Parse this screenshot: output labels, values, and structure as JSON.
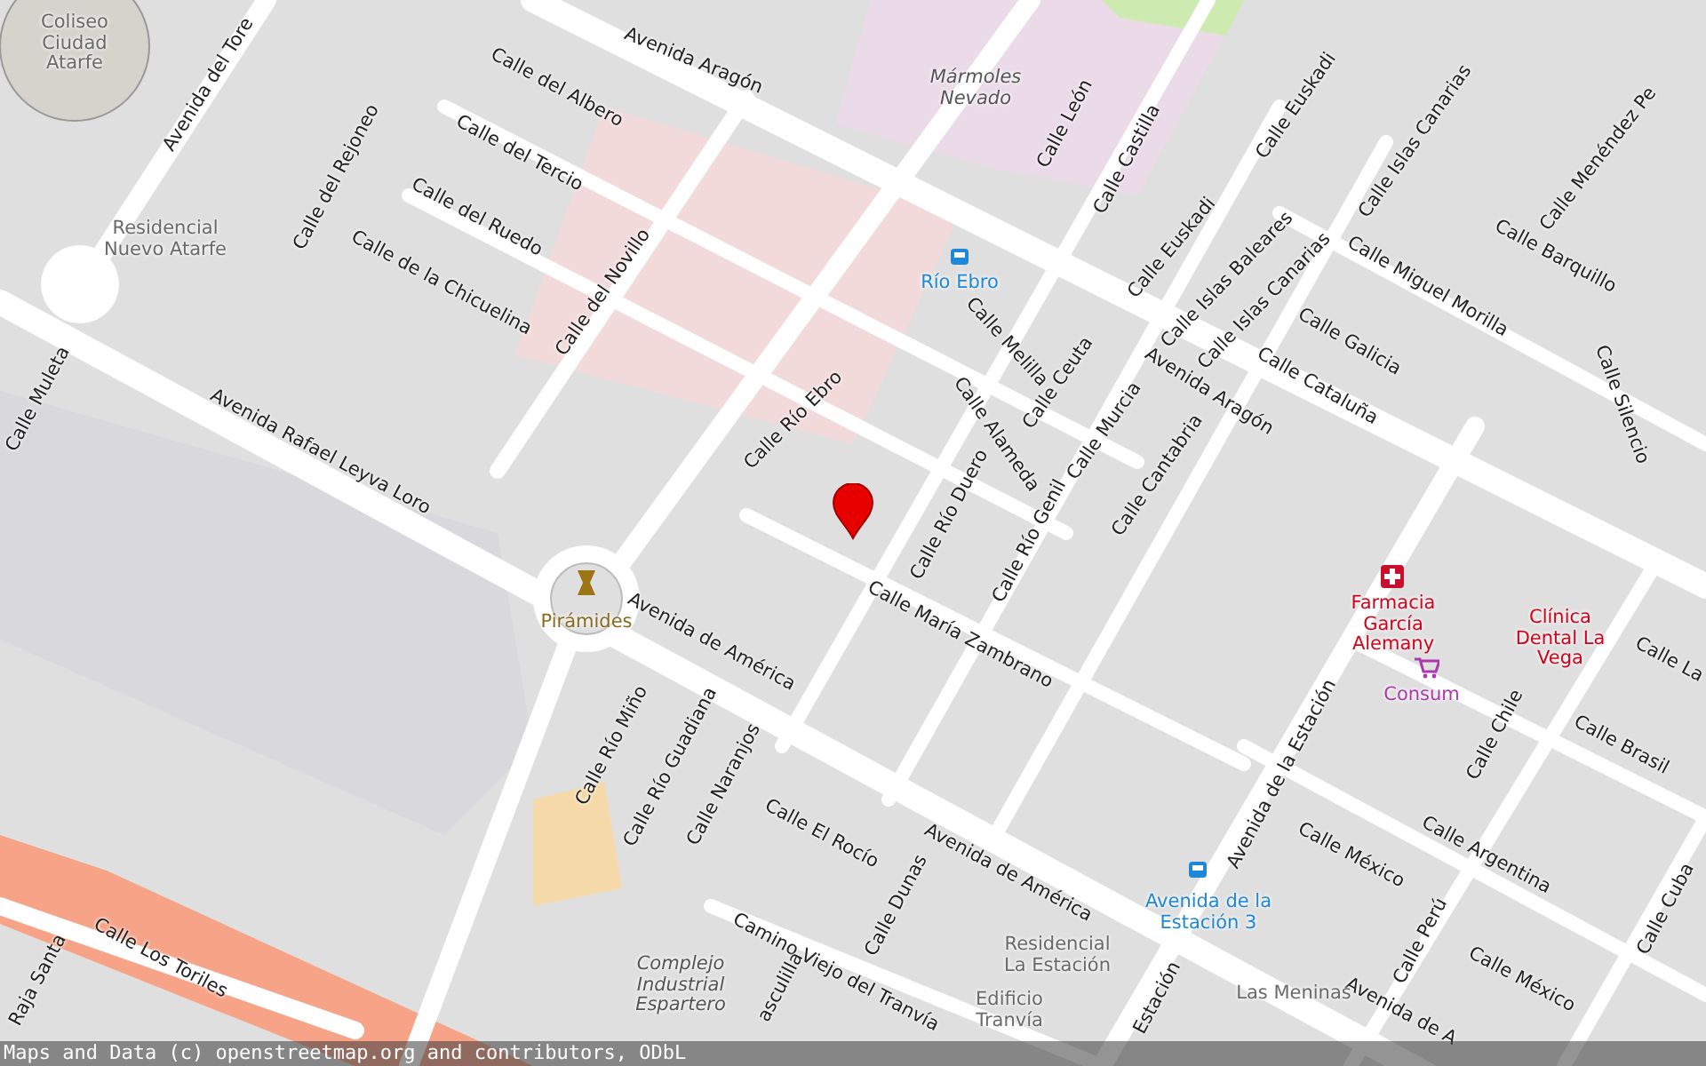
{
  "map": {
    "labels": [
      {
        "text": "Avenida del Tore",
        "kind": "street"
      },
      {
        "text": "Calle del Albero",
        "kind": "street"
      },
      {
        "text": "Avenida Aragón",
        "kind": "street"
      },
      {
        "text": "Calle del Tercio",
        "kind": "street"
      },
      {
        "text": "Calle del Rejoneo",
        "kind": "street"
      },
      {
        "text": "Calle del Ruedo",
        "kind": "street"
      },
      {
        "text": "Calle de la Chicuelina",
        "kind": "street"
      },
      {
        "text": "Calle del Novillo",
        "kind": "street"
      },
      {
        "text": "Calle Muleta",
        "kind": "street"
      },
      {
        "text": "Avenida Rafael Leyva Loro",
        "kind": "street"
      },
      {
        "text": "Calle Río Ebro",
        "kind": "street"
      },
      {
        "text": "Calle Melilla",
        "kind": "street"
      },
      {
        "text": "Calle Ceuta",
        "kind": "street"
      },
      {
        "text": "Calle Alameda",
        "kind": "street"
      },
      {
        "text": "Calle Río Duero",
        "kind": "street"
      },
      {
        "text": "Calle Murcia",
        "kind": "street"
      },
      {
        "text": "Calle Río Genil",
        "kind": "street"
      },
      {
        "text": "Calle Cantabria",
        "kind": "street"
      },
      {
        "text": "Avenida Aragón",
        "kind": "street"
      },
      {
        "text": "Calle León",
        "kind": "street"
      },
      {
        "text": "Calle Castilla",
        "kind": "street"
      },
      {
        "text": "Calle Euskadi",
        "kind": "street"
      },
      {
        "text": "Calle Euskadi",
        "kind": "street"
      },
      {
        "text": "Calle Islas Baleares",
        "kind": "street"
      },
      {
        "text": "Calle Islas Canarias",
        "kind": "street"
      },
      {
        "text": "Calle Islas Canarias",
        "kind": "street"
      },
      {
        "text": "Calle Menéndez Pe",
        "kind": "street"
      },
      {
        "text": "Calle Barquillo",
        "kind": "street"
      },
      {
        "text": "Calle Miguel Morilla",
        "kind": "street"
      },
      {
        "text": "Calle Galicia",
        "kind": "street"
      },
      {
        "text": "Calle Cataluña",
        "kind": "street"
      },
      {
        "text": "Calle Silencio",
        "kind": "street"
      },
      {
        "text": "Calle María Zambrano",
        "kind": "street"
      },
      {
        "text": "Avenida de América",
        "kind": "street"
      },
      {
        "text": "Calle Río Miño",
        "kind": "street"
      },
      {
        "text": "Calle Río Guadiana",
        "kind": "street"
      },
      {
        "text": "Calle Naranjos",
        "kind": "street"
      },
      {
        "text": "Calle El Rocío",
        "kind": "street"
      },
      {
        "text": "Avenida de América",
        "kind": "street"
      },
      {
        "text": "Calle Dunas",
        "kind": "street"
      },
      {
        "text": "Camino Viejo del Tranvía",
        "kind": "street"
      },
      {
        "text": "Calle Los Toriles",
        "kind": "street"
      },
      {
        "text": "Raja Santa",
        "kind": "street"
      },
      {
        "text": "asculilla",
        "kind": "street"
      },
      {
        "text": "Avenida de la Estación",
        "kind": "street"
      },
      {
        "text": "Calle Chile",
        "kind": "street"
      },
      {
        "text": "Calle Brasil",
        "kind": "street"
      },
      {
        "text": "Calle Argentina",
        "kind": "street"
      },
      {
        "text": "Calle México",
        "kind": "street"
      },
      {
        "text": "Calle México",
        "kind": "street"
      },
      {
        "text": "Calle Perú",
        "kind": "street"
      },
      {
        "text": "Calle Cuba",
        "kind": "street"
      },
      {
        "text": "Calle La",
        "kind": "street"
      },
      {
        "text": "Estación",
        "kind": "street"
      },
      {
        "text": "Avenida de A",
        "kind": "street"
      },
      {
        "text": "Coliseo Ciudad Atarfe",
        "kind": "place"
      },
      {
        "text": "Residencial Nuevo Atarfe",
        "kind": "place"
      },
      {
        "text": "Mármoles Nevado",
        "kind": "landmark"
      },
      {
        "text": "Río Ebro",
        "kind": "transit"
      },
      {
        "text": "Pirámides",
        "kind": "monument"
      },
      {
        "text": "Farmacia García Alemany",
        "kind": "health"
      },
      {
        "text": "Consum",
        "kind": "shop"
      },
      {
        "text": "Clínica Dental La Vega",
        "kind": "health"
      },
      {
        "text": "Avenida de la Estación 3",
        "kind": "transit"
      },
      {
        "text": "Complejo Industrial Espartero",
        "kind": "landmark"
      },
      {
        "text": "Residencial La Estación",
        "kind": "place"
      },
      {
        "text": "Edificio Tranvía",
        "kind": "place"
      },
      {
        "text": "Las Meninas",
        "kind": "place"
      }
    ]
  },
  "attribution": "Maps and Data (c) openstreetmap.org and contributors, ODbL"
}
